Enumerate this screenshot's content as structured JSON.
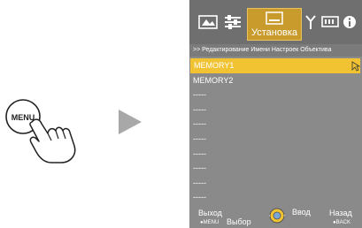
{
  "illustration": {
    "button_label": "MENU"
  },
  "tabs": [
    {
      "icon": "picture-icon"
    },
    {
      "icon": "sliders-icon"
    },
    {
      "icon": "installation-icon",
      "label": "Установка",
      "active": true
    },
    {
      "icon": "antenna-icon"
    },
    {
      "icon": "display-icon"
    },
    {
      "icon": "info-icon"
    }
  ],
  "breadcrumb": ">> Редактирование Имени Настроек Объектива",
  "list": [
    {
      "label": "MEMORY1",
      "selected": true
    },
    {
      "label": "MEMORY2"
    },
    {
      "label": "-----"
    },
    {
      "label": "-----"
    },
    {
      "label": "-----"
    },
    {
      "label": "-----"
    },
    {
      "label": "-----"
    },
    {
      "label": "-----"
    },
    {
      "label": "-----"
    },
    {
      "label": "-----"
    }
  ],
  "footer": {
    "exit_label": "Выход",
    "exit_sub": "●MENU",
    "select_label": "Выбор",
    "enter_label": "Ввод",
    "back_label": "Назад",
    "back_sub": "●BACK"
  },
  "colors": {
    "panel_bg": "#8a8a8a",
    "tabbar_bg": "#6f6f6f",
    "active_tab": "#c89b2c",
    "selected_row": "#f1c232"
  }
}
